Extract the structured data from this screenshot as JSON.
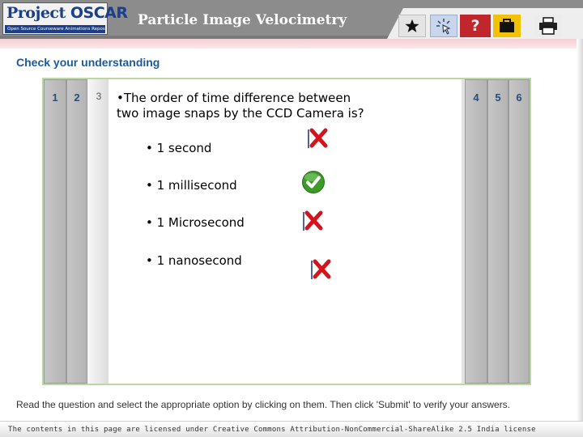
{
  "header": {
    "logo_project": "Project",
    "logo_oscar": "OSCAR",
    "logo_tagline": "Open Source Courseware Animations Repository",
    "title": "Particle Image Velocimetry",
    "toolbar": [
      {
        "name": "star-icon",
        "label": ""
      },
      {
        "name": "pointer-icon",
        "label": ""
      },
      {
        "name": "help-icon",
        "label": "?"
      },
      {
        "name": "briefcase-icon",
        "label": ""
      },
      {
        "name": "print-icon",
        "label": ""
      }
    ]
  },
  "page": {
    "section_title": "Check your understanding",
    "tabs_left": [
      "1",
      "2",
      "3"
    ],
    "tabs_right": [
      "4",
      "5",
      "6"
    ],
    "current_tab": "3",
    "question": "•The order of time difference between two image snaps by the CCD Camera  is?",
    "options": [
      {
        "label": "• 1 second",
        "result": "incorrect"
      },
      {
        "label": "• 1 millisecond",
        "result": "correct"
      },
      {
        "label": "• 1 Microsecond",
        "result": "incorrect"
      },
      {
        "label": "• 1 nanosecond",
        "result": "incorrect"
      }
    ],
    "instructions": "Read the question and select the appropriate option by clicking on them. Then click 'Submit' to verify your answers."
  },
  "footer": {
    "license": "The contents in this page are licensed under Creative Commons Attribution-NonCommercial-ShareAlike 2.5 India license"
  },
  "colors": {
    "header_gray": "#8c8c8c",
    "accent_blue": "#1a5aa0",
    "border_green": "#b9d8a4",
    "wrong_red": "#d4141c",
    "right_green": "#3c9a28"
  }
}
